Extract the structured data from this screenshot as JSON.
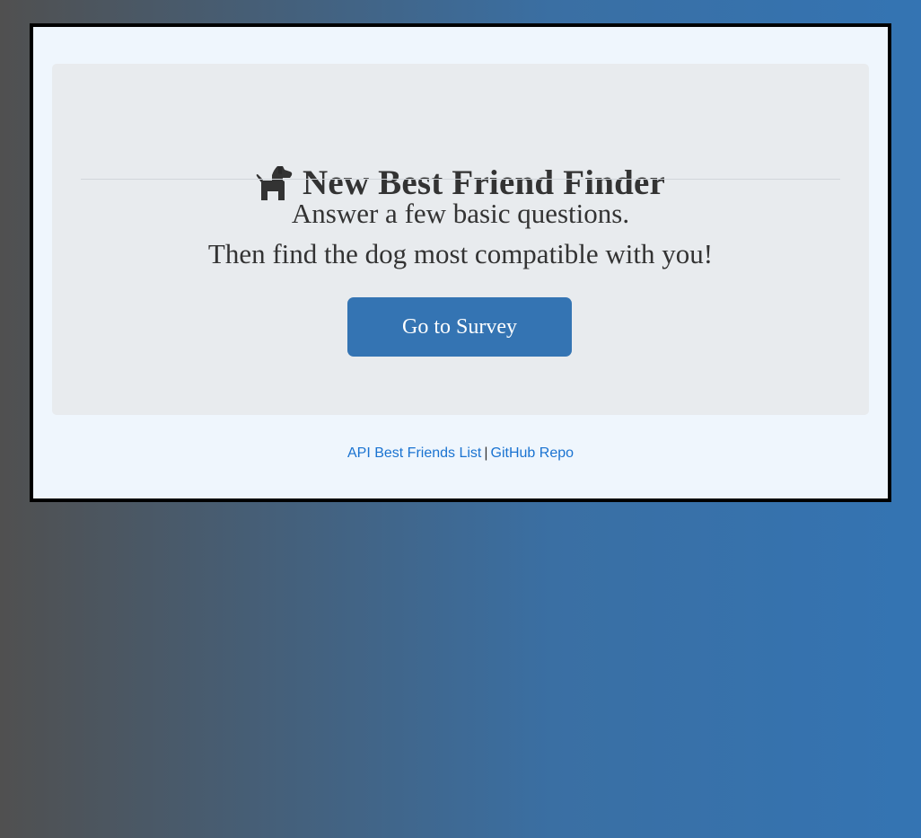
{
  "header": {
    "title": "New Best Friend Finder",
    "icon": "dog-icon"
  },
  "intro": {
    "line1": "Answer a few basic questions.",
    "line2": "Then find the dog most compatible with you!"
  },
  "cta": {
    "label": "Go to Survey"
  },
  "footer": {
    "link_api": "API Best Friends List",
    "separator": "|",
    "link_repo": "GitHub Repo"
  },
  "colors": {
    "accent": "#3474b3",
    "link": "#1a73d1",
    "text": "#333333",
    "panel": "#e8ebee",
    "card": "#eff6fd"
  }
}
